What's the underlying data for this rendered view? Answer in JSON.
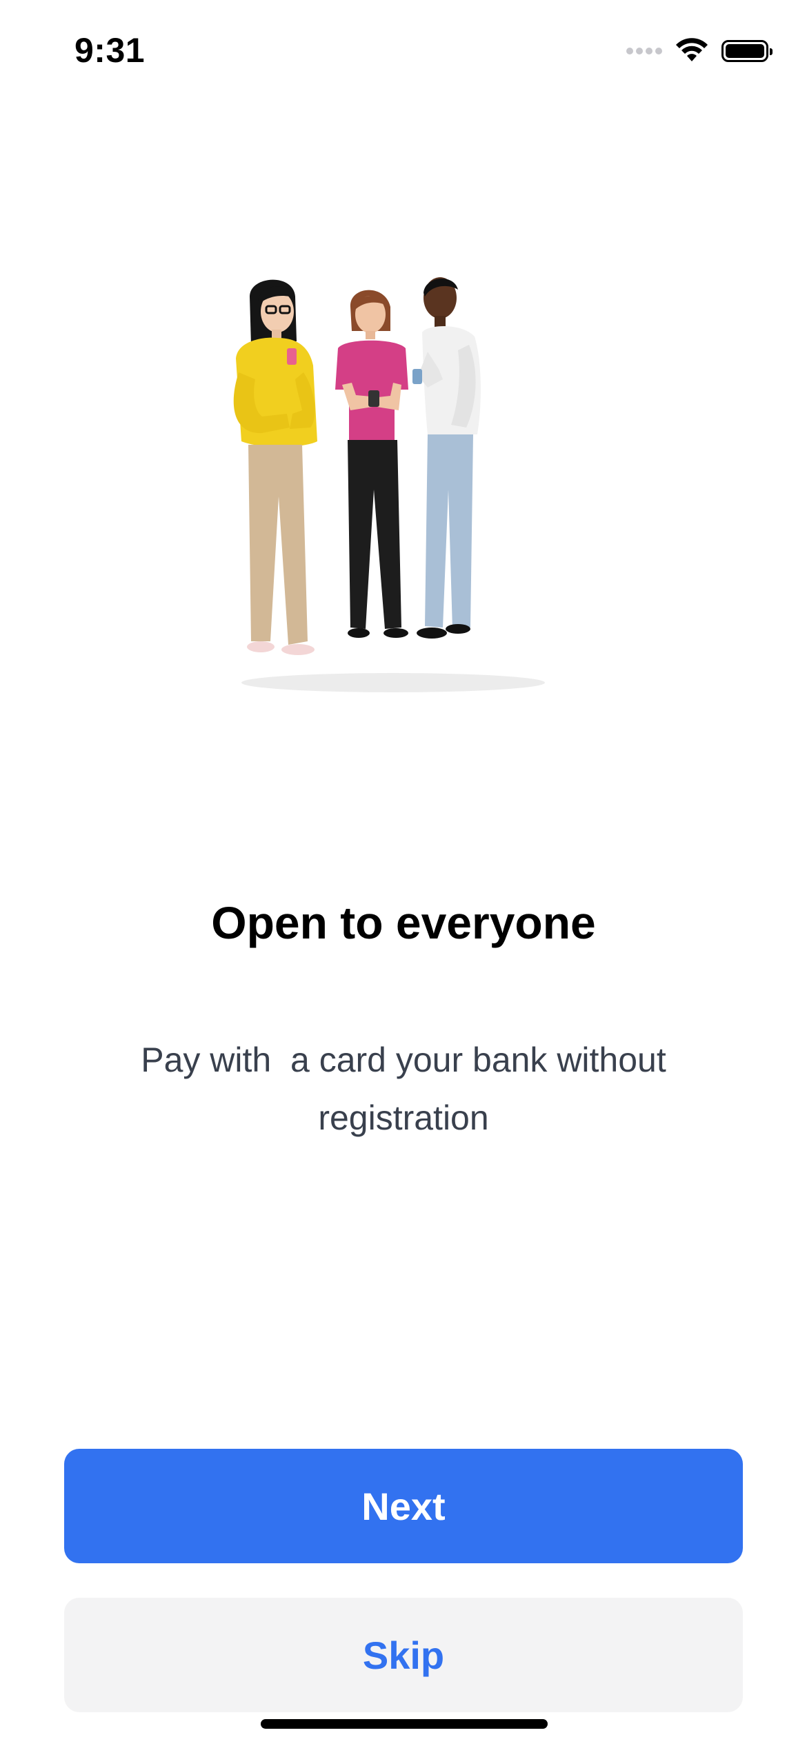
{
  "status_bar": {
    "time": "9:31",
    "icons": [
      "signal-icon",
      "wifi-icon",
      "battery-icon"
    ]
  },
  "illustration": {
    "icon": "people-illustration"
  },
  "onboarding": {
    "title": "Open to everyone",
    "description": "Pay with  a card your bank without registration"
  },
  "actions": {
    "next_label": "Next",
    "skip_label": "Skip"
  },
  "colors": {
    "accent": "#3272f0",
    "secondary_button_bg": "#f3f3f4",
    "description_text": "#39404d"
  }
}
